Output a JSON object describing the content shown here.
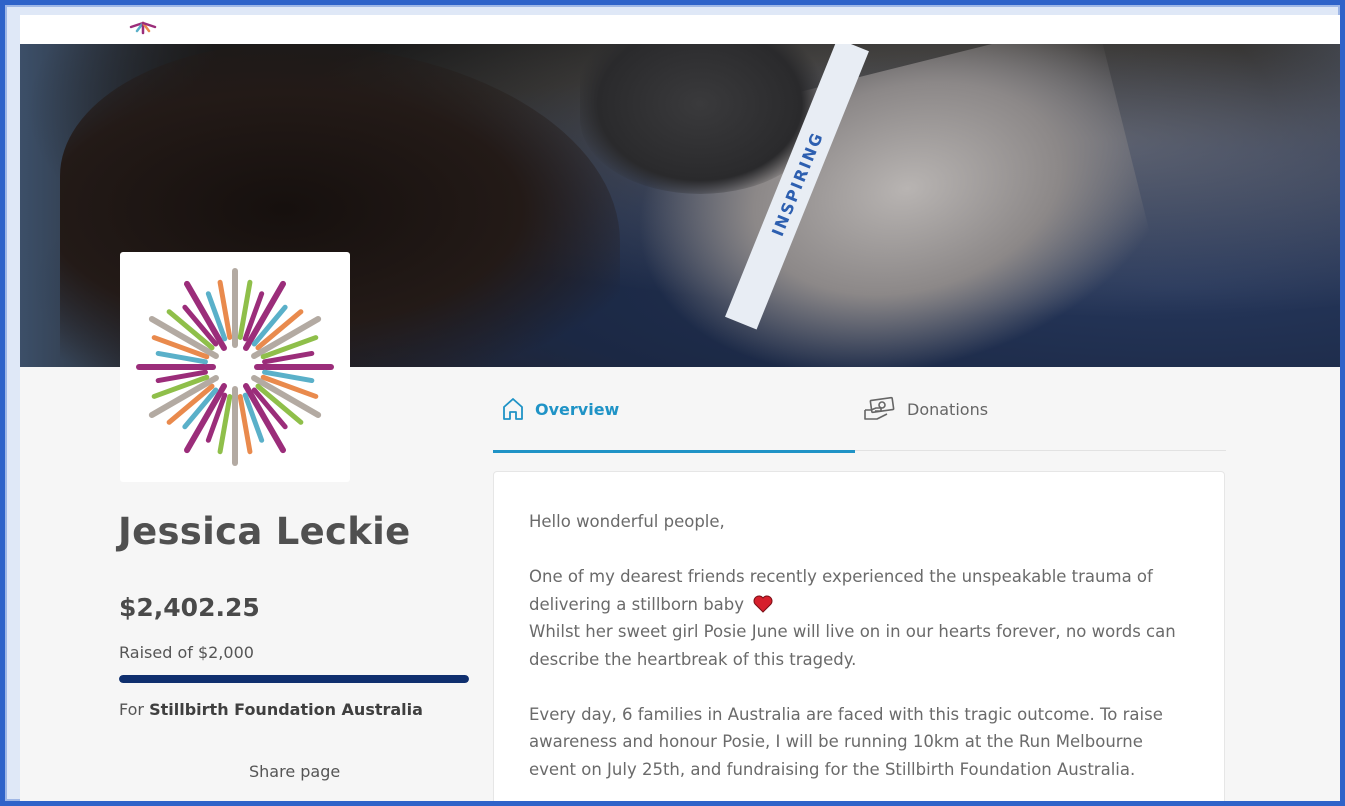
{
  "profile": {
    "name": "Jessica Leckie",
    "amount_raised": "$2,402.25",
    "raised_of": "Raised of $2,000",
    "progress_fraction": 1.0,
    "for_prefix": "For",
    "charity": "Stillbirth Foundation Australia",
    "share_label": "Share page"
  },
  "hero": {
    "lanyard_text": "INSPIRING"
  },
  "tabs": [
    {
      "label": "Overview",
      "icon": "home-icon",
      "active": true
    },
    {
      "label": "Donations",
      "icon": "donation-hand-icon",
      "active": false
    }
  ],
  "content": {
    "greeting": "Hello wonderful people,",
    "para1_a": "One of my dearest friends recently experienced the unspeakable trauma of delivering a stillborn baby",
    "para1_b": "Whilst her sweet girl Posie June will live on in our hearts forever, no words can describe the heartbreak of this tragedy.",
    "para2": "Every day, 6 families in Australia are faced with this tragic outcome. To raise awareness and honour Posie, I will be running 10km at the Run Melbourne event on July 25th, and fundraising for the Stillbirth Foundation Australia."
  },
  "colors": {
    "accent": "#1f93c6",
    "progress": "#0f2f6e",
    "frame": "#2f63c9"
  }
}
